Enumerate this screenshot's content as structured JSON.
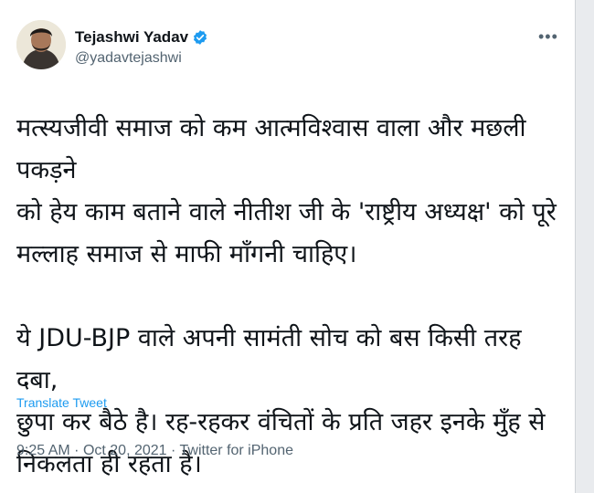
{
  "author": {
    "display_name": "Tejashwi Yadav",
    "handle": "@yadavtejashwi",
    "verified": true
  },
  "tweet": {
    "paragraphs": [
      "मत्स्यजीवी समाज को कम आत्मविश्वास वाला और मछली पकड़ने\nको हेय काम बताने वाले नीतीश जी के 'राष्ट्रीय अध्यक्ष' को पूरे\nमल्लाह समाज से माफी माँगनी चाहिए।",
      "ये JDU-BJP वाले अपनी सामंती सोच को बस किसी तरह दबा,\nछुपा कर बैठे है। रह-रहकर वंचितों के प्रति जहर इनके मुँह से\nनिकलता ही रहता है।"
    ],
    "translate_label": "Translate Tweet",
    "time": "9:25 AM",
    "date": "Oct 20, 2021",
    "separator": "·",
    "source": "Twitter for iPhone"
  },
  "colors": {
    "text": "#0f1419",
    "secondary": "#536471",
    "accent": "#1d9bf0"
  },
  "icons": {
    "more": "more-options-icon",
    "verified": "verified-badge-icon"
  }
}
